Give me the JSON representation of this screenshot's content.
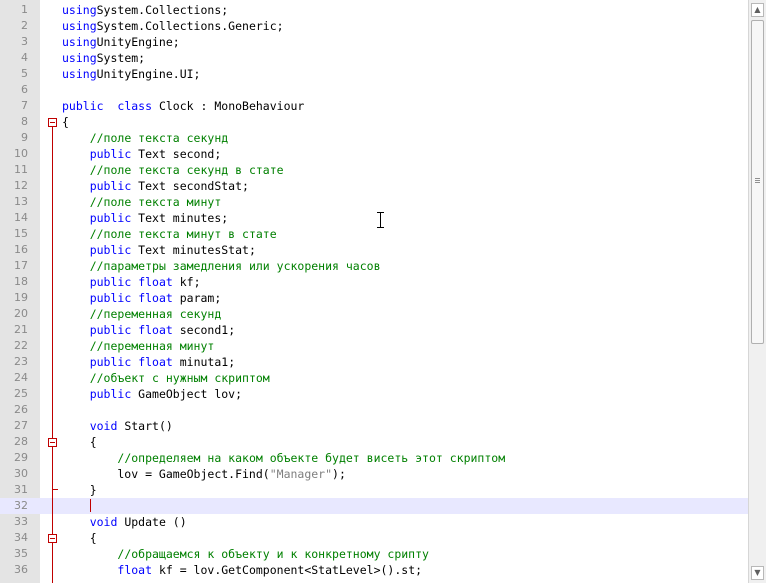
{
  "editor": {
    "lines": [
      {
        "n": "1",
        "t": [
          [
            "kw",
            "using"
          ],
          [
            "",
            "System.Collections;"
          ]
        ]
      },
      {
        "n": "2",
        "t": [
          [
            "kw",
            "using"
          ],
          [
            "",
            "System.Collections.Generic;"
          ]
        ]
      },
      {
        "n": "3",
        "t": [
          [
            "kw",
            "using"
          ],
          [
            "",
            "UnityEngine;"
          ]
        ]
      },
      {
        "n": "4",
        "t": [
          [
            "kw",
            "using"
          ],
          [
            "",
            "System;"
          ]
        ]
      },
      {
        "n": "5",
        "t": [
          [
            "kw",
            "using"
          ],
          [
            "",
            "UnityEngine.UI;"
          ]
        ]
      },
      {
        "n": "6",
        "t": []
      },
      {
        "n": "7",
        "t": [
          [
            "kw",
            "public"
          ],
          [
            "",
            "  "
          ],
          [
            "kw",
            "class"
          ],
          [
            "",
            " Clock : MonoBehaviour"
          ]
        ]
      },
      {
        "n": "8",
        "t": [
          [
            "",
            "{"
          ]
        ]
      },
      {
        "n": "9",
        "t": [
          [
            "",
            "    "
          ],
          [
            "com",
            "//поле текста секунд"
          ]
        ]
      },
      {
        "n": "10",
        "t": [
          [
            "",
            "    "
          ],
          [
            "kw",
            "public"
          ],
          [
            "",
            " Text second;"
          ]
        ]
      },
      {
        "n": "11",
        "t": [
          [
            "",
            "    "
          ],
          [
            "com",
            "//поле текста секунд в стате"
          ]
        ]
      },
      {
        "n": "12",
        "t": [
          [
            "",
            "    "
          ],
          [
            "kw",
            "public"
          ],
          [
            "",
            " Text secondStat;"
          ]
        ]
      },
      {
        "n": "13",
        "t": [
          [
            "",
            "    "
          ],
          [
            "com",
            "//поле текста минут"
          ]
        ]
      },
      {
        "n": "14",
        "t": [
          [
            "",
            "    "
          ],
          [
            "kw",
            "public"
          ],
          [
            "",
            " Text minutes;"
          ]
        ]
      },
      {
        "n": "15",
        "t": [
          [
            "",
            "    "
          ],
          [
            "com",
            "//поле текста минут в стате"
          ]
        ]
      },
      {
        "n": "16",
        "t": [
          [
            "",
            "    "
          ],
          [
            "kw",
            "public"
          ],
          [
            "",
            " Text minutesStat;"
          ]
        ]
      },
      {
        "n": "17",
        "t": [
          [
            "",
            "    "
          ],
          [
            "com",
            "//параметры замедления или ускорения часов"
          ]
        ]
      },
      {
        "n": "18",
        "t": [
          [
            "",
            "    "
          ],
          [
            "kw",
            "public"
          ],
          [
            "",
            " "
          ],
          [
            "kw",
            "float"
          ],
          [
            "",
            " kf;"
          ]
        ]
      },
      {
        "n": "19",
        "t": [
          [
            "",
            "    "
          ],
          [
            "kw",
            "public"
          ],
          [
            "",
            " "
          ],
          [
            "kw",
            "float"
          ],
          [
            "",
            " param;"
          ]
        ]
      },
      {
        "n": "20",
        "t": [
          [
            "",
            "    "
          ],
          [
            "com",
            "//переменная секунд"
          ]
        ]
      },
      {
        "n": "21",
        "t": [
          [
            "",
            "    "
          ],
          [
            "kw",
            "public"
          ],
          [
            "",
            " "
          ],
          [
            "kw",
            "float"
          ],
          [
            "",
            " second1;"
          ]
        ]
      },
      {
        "n": "22",
        "t": [
          [
            "",
            "    "
          ],
          [
            "com",
            "//переменная минут"
          ]
        ]
      },
      {
        "n": "23",
        "t": [
          [
            "",
            "    "
          ],
          [
            "kw",
            "public"
          ],
          [
            "",
            " "
          ],
          [
            "kw",
            "float"
          ],
          [
            "",
            " minuta1;"
          ]
        ]
      },
      {
        "n": "24",
        "t": [
          [
            "",
            "    "
          ],
          [
            "com",
            "//объект с нужным скриптом"
          ]
        ]
      },
      {
        "n": "25",
        "t": [
          [
            "",
            "    "
          ],
          [
            "kw",
            "public"
          ],
          [
            "",
            " GameObject lov;"
          ]
        ]
      },
      {
        "n": "26",
        "t": []
      },
      {
        "n": "27",
        "t": [
          [
            "",
            "    "
          ],
          [
            "kw",
            "void"
          ],
          [
            "",
            " Start()"
          ]
        ]
      },
      {
        "n": "28",
        "t": [
          [
            "",
            "    {"
          ]
        ]
      },
      {
        "n": "29",
        "t": [
          [
            "",
            "        "
          ],
          [
            "com",
            "//определяем на каком объекте будет висеть этот скриптом"
          ]
        ]
      },
      {
        "n": "30",
        "t": [
          [
            "",
            "        lov = GameObject.Find("
          ],
          [
            "str",
            "\"Manager\""
          ],
          [
            "",
            ");"
          ]
        ]
      },
      {
        "n": "31",
        "t": [
          [
            "",
            "    }"
          ]
        ]
      },
      {
        "n": "32",
        "t": []
      },
      {
        "n": "33",
        "t": [
          [
            "",
            "    "
          ],
          [
            "kw",
            "void"
          ],
          [
            "",
            " Update ()"
          ]
        ]
      },
      {
        "n": "34",
        "t": [
          [
            "",
            "    {"
          ]
        ]
      },
      {
        "n": "35",
        "t": [
          [
            "",
            "        "
          ],
          [
            "com",
            "//обращаемся к объекту и к конкретному срипту"
          ]
        ]
      },
      {
        "n": "36",
        "t": [
          [
            "",
            "        "
          ],
          [
            "kw",
            "float"
          ],
          [
            "",
            " kf = lov.GetComponent<StatLevel>().st;"
          ]
        ]
      }
    ],
    "current_line": "32",
    "fold_markers": [
      "8",
      "28",
      "34"
    ]
  },
  "scrollbar": {
    "up_arrow": "▲",
    "down_arrow": "▼"
  }
}
